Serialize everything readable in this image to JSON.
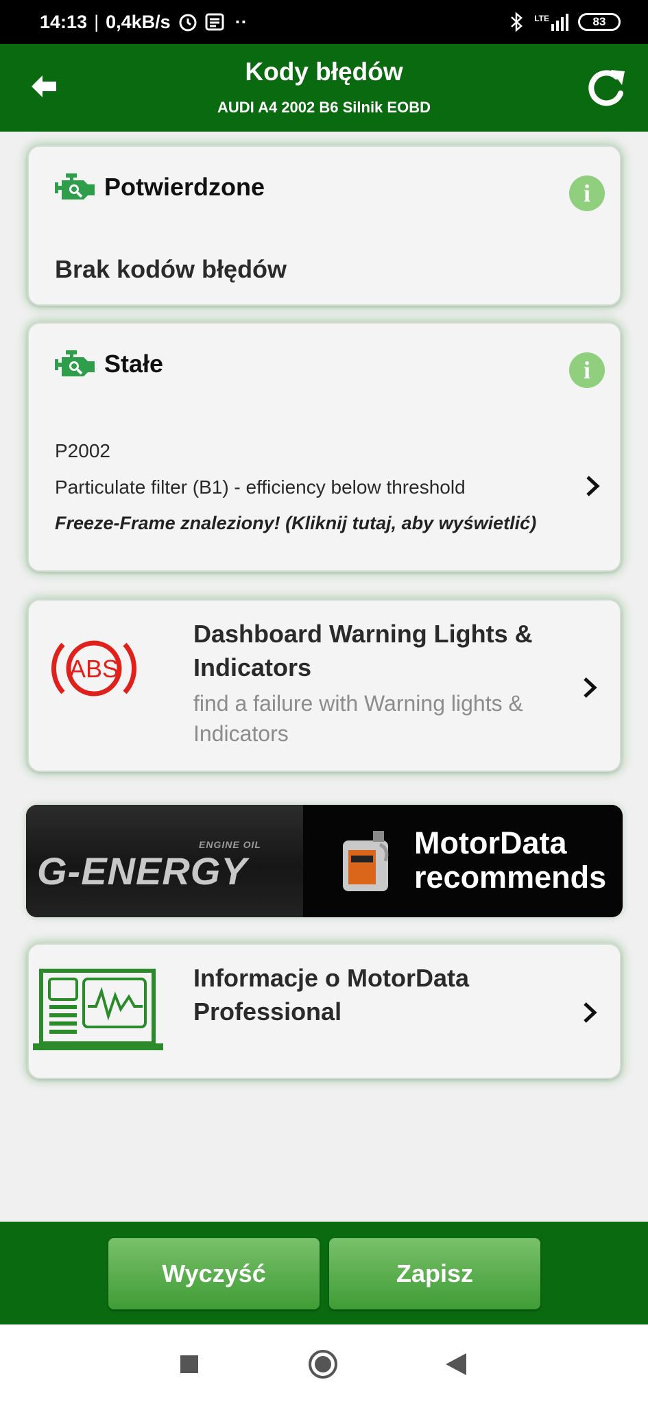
{
  "status_bar": {
    "time": "14:13",
    "speed": "0,4kB/s",
    "dots": "··",
    "network": "LTE",
    "battery": "83",
    "icons": [
      "alarm-icon",
      "notification-icon",
      "bluetooth-icon",
      "signal-icon",
      "battery-icon"
    ]
  },
  "header": {
    "title": "Kody błędów",
    "subtitle": "AUDI A4 2002 B6 Silnik EOBD",
    "back_icon": "arrow-left-icon",
    "refresh_icon": "refresh-icon",
    "background": "#0a6a10"
  },
  "confirmed": {
    "title": "Potwierdzone",
    "message": "Brak kodów błędów",
    "info_label": "i"
  },
  "permanent": {
    "title": "Stałe",
    "info_label": "i",
    "code": "P2002",
    "description": "Particulate filter (B1) - efficiency below threshold",
    "freeze_frame": "Freeze-Frame znaleziony! (Kliknij tutaj, aby wyświetlić)"
  },
  "dashboard": {
    "icon_text": "ABS",
    "title": "Dashboard Warning Lights & Indicators",
    "subtitle": "find a failure with Warning lights & Indicators"
  },
  "banner": {
    "brand_small": "ENGINE OIL",
    "brand": "G-ENERGY",
    "line1": "MotorData",
    "line2": "recommends"
  },
  "pro": {
    "title": "Informacje o MotorData Professional"
  },
  "buttons": {
    "clear": "Wyczyść",
    "save": "Zapisz"
  },
  "colors": {
    "primary": "#0a6a10",
    "accent": "#8fcf7d",
    "abs_red": "#e0211b"
  }
}
